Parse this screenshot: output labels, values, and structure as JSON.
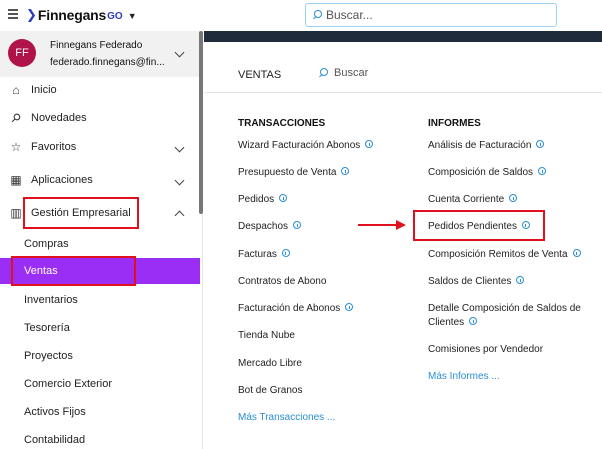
{
  "header": {
    "brand_name": "Finnegans",
    "brand_suffix": "GO",
    "search_placeholder": "Buscar..."
  },
  "user": {
    "initials": "FF",
    "name": "Finnegans Federado",
    "email": "federado.finnegans@fin..."
  },
  "sidebar": {
    "items": [
      {
        "label": "Inicio",
        "icon": "home-icon"
      },
      {
        "label": "Novedades",
        "icon": "pin-icon"
      },
      {
        "label": "Favoritos",
        "icon": "star-icon"
      },
      {
        "label": "Aplicaciones",
        "icon": "apps-grid-icon"
      },
      {
        "label": "Gestión Empresarial",
        "icon": "building-icon"
      }
    ],
    "subitems": [
      "Compras",
      "Ventas",
      "Inventarios",
      "Tesorería",
      "Proyectos",
      "Comercio Exterior",
      "Activos Fijos",
      "Contabilidad"
    ],
    "active_subitem": "Ventas"
  },
  "main": {
    "title": "VENTAS",
    "search_placeholder": "Buscar",
    "transacciones": {
      "title": "TRANSACCIONES",
      "items": [
        "Wizard Facturación Abonos",
        "Presupuesto de Venta",
        "Pedidos",
        "Despachos",
        "Facturas",
        "Contratos de Abono",
        "Facturación de Abonos",
        "Tienda Nube",
        "Mercado Libre",
        "Bot de Granos"
      ],
      "more": "Más Transacciones ..."
    },
    "informes": {
      "title": "INFORMES",
      "items": [
        "Análisis de Facturación",
        "Composición de Saldos",
        "Cuenta Corriente",
        "Pedidos Pendientes",
        "Composición Remitos de Venta",
        "Saldos de Clientes",
        "Detalle Composición de Saldos de",
        "Clientes",
        "Comisiones por Vendedor"
      ],
      "more": "Más Informes ..."
    }
  },
  "colors": {
    "accent": "#9b2ef5",
    "highlight": "#e0101e",
    "link": "#2a8ed4",
    "avatar": "#b0124a"
  }
}
